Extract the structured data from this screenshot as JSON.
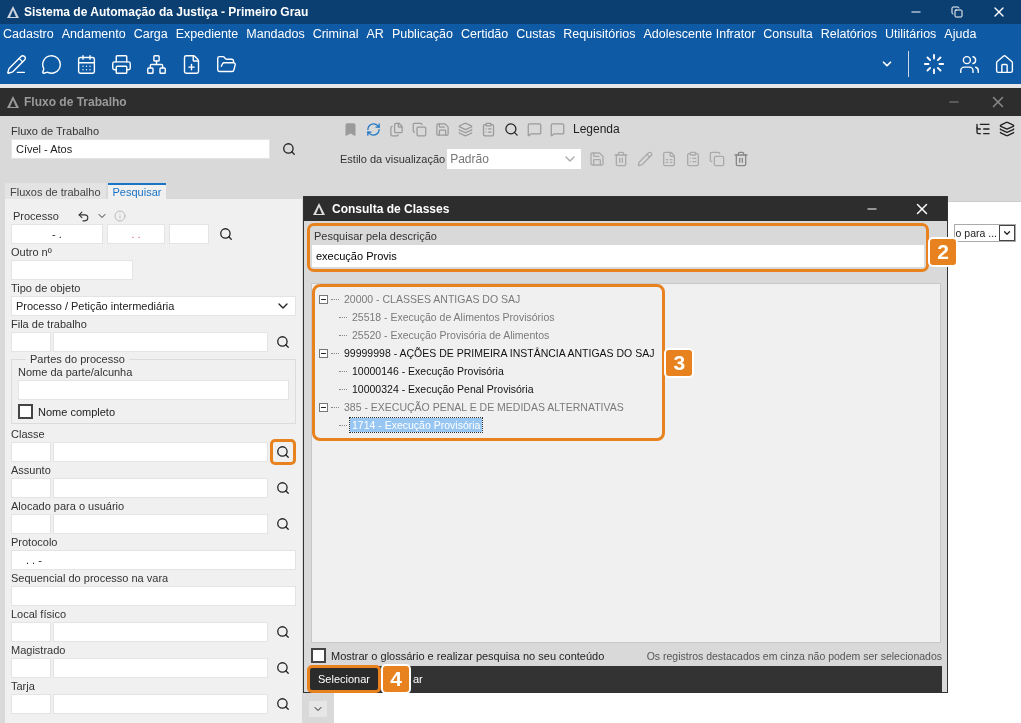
{
  "window": {
    "title": "Sistema de Automação da Justiça - Primeiro Grau"
  },
  "menu": [
    "Cadastro",
    "Andamento",
    "Carga",
    "Expediente",
    "Mandados",
    "Criminal",
    "AR",
    "Publicação",
    "Certidão",
    "Custas",
    "Requisitórios",
    "Adolescente Infrator",
    "Consulta",
    "Relatórios",
    "Utilitários",
    "Ajuda"
  ],
  "workflow_window": {
    "title": "Fluxo de Trabalho"
  },
  "workflow_field": {
    "label": "Fluxo de Trabalho",
    "value": "Cível - Atos"
  },
  "view_toolbar": {
    "legend": "Legenda",
    "style_label": "Estilo da visualização",
    "style_value": "Padrão"
  },
  "tabs": [
    {
      "label": "Fluxos de trabalho",
      "selected": false
    },
    {
      "label": "Pesquisar",
      "selected": true
    }
  ],
  "form": [
    {
      "kind": "process",
      "label": "Processo",
      "masks": [
        "- .",
        ". ."
      ],
      "highlighted": false
    },
    {
      "kind": "short",
      "label": "Outro nº",
      "highlighted": false
    },
    {
      "kind": "select",
      "label": "Tipo de objeto",
      "value": "Processo / Petição intermediária",
      "highlighted": false
    },
    {
      "kind": "lookup",
      "label": "Fila de trabalho",
      "highlighted": false
    },
    {
      "kind": "group",
      "label": "Partes do processo",
      "field_label": "Nome da parte/alcunha",
      "checkbox": {
        "label": "Nome completo",
        "checked": false
      },
      "highlighted": false
    },
    {
      "kind": "lookup",
      "label": "Classe",
      "highlighted": true
    },
    {
      "kind": "lookup",
      "label": "Assunto",
      "highlighted": false
    },
    {
      "kind": "lookup",
      "label": "Alocado para o usuário",
      "highlighted": false
    },
    {
      "kind": "text",
      "label": "Protocolo",
      "value": ". .  -",
      "highlighted": false
    },
    {
      "kind": "text",
      "label": "Sequencial do processo na vara",
      "highlighted": false
    },
    {
      "kind": "lookup",
      "label": "Local físico",
      "highlighted": false
    },
    {
      "kind": "lookup",
      "label": "Magistrado",
      "highlighted": false
    },
    {
      "kind": "lookup",
      "label": "Tarja",
      "highlighted": false
    }
  ],
  "result_panel": {
    "column_filter": "o para ..."
  },
  "dialog": {
    "title": "Consulta de Classes",
    "search_label": "Pesquisar pela descrição",
    "search_value": "execução Provis",
    "search_badge": "2",
    "tree": [
      {
        "label": "20000 - CLASSES ANTIGAS DO SAJ",
        "disabled": true,
        "expanded": true,
        "selected": false,
        "children": [
          {
            "label": "25518 - Execução de Alimentos Provisórios",
            "disabled": true,
            "selected": false
          },
          {
            "label": "25520 - Execução Provisória de Alimentos",
            "disabled": true,
            "selected": false
          }
        ]
      },
      {
        "label": "99999998 - AÇÕES DE PRIMEIRA INSTÂNCIA ANTIGAS DO SAJ",
        "disabled": false,
        "expanded": true,
        "selected": false,
        "children": [
          {
            "label": "10000146 - Execução Provisória",
            "disabled": false,
            "selected": false
          },
          {
            "label": "10000324 - Execução Penal Provisória",
            "disabled": false,
            "selected": false
          }
        ]
      },
      {
        "label": "385 - EXECUÇÃO PENAL E DE MEDIDAS ALTERNATIVAS",
        "disabled": true,
        "expanded": true,
        "selected": false,
        "children": [
          {
            "label": "1714 - Execução Provisória",
            "disabled": true,
            "selected": true
          }
        ]
      }
    ],
    "tree_badge": "3",
    "glossary": {
      "label": "Mostrar o glossário e realizar pesquisa no seu conteúdo",
      "checked": false
    },
    "note": "Os registros destacados em cinza não podem ser selecionados",
    "select_button": "Selecionar",
    "select_badge": "4",
    "cancel_partial": "ar"
  }
}
